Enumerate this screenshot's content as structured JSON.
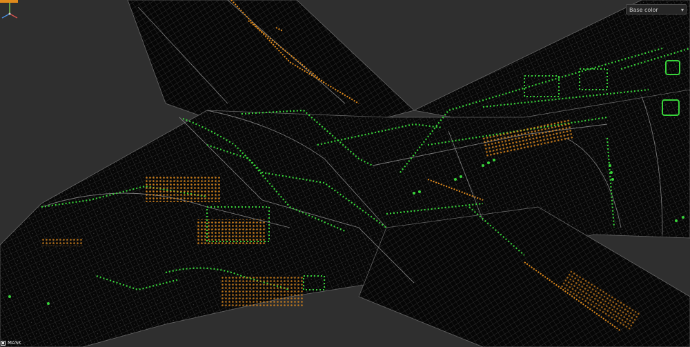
{
  "viewport": {
    "background_color": "#2f2f2f",
    "mesh_color": "#070707",
    "wire_color": "#5a5a5a",
    "mask_green": "#38d43a",
    "mask_orange": "#e08a1c"
  },
  "channel_selector": {
    "value": "Base color",
    "icon": "chevron-down-icon"
  },
  "mask_label": {
    "text": "MASK",
    "icon": "mask-icon"
  },
  "axis_gizmo": {
    "icon": "axis-gizmo-icon"
  }
}
